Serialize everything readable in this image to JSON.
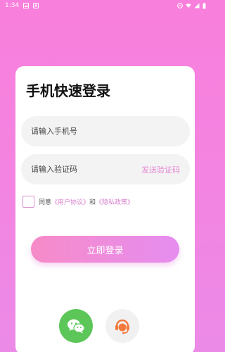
{
  "status_bar": {
    "time": "1:34"
  },
  "login": {
    "title": "手机快速登录",
    "phone_placeholder": "请输入手机号",
    "code_placeholder": "请输入验证码",
    "send_code": "发送验证码",
    "agree_prefix": "同意",
    "user_agreement": "《用户协议》",
    "and": "和",
    "privacy_policy": "《隐私政策》",
    "login_button": "立即登录"
  },
  "colors": {
    "background_top": "#f97fdc",
    "accent": "#e68ad6",
    "wechat_green": "#5cc658",
    "service_orange": "#f37a3c"
  },
  "icons": {
    "wechat": "wechat-icon",
    "service": "customer-service-icon"
  }
}
